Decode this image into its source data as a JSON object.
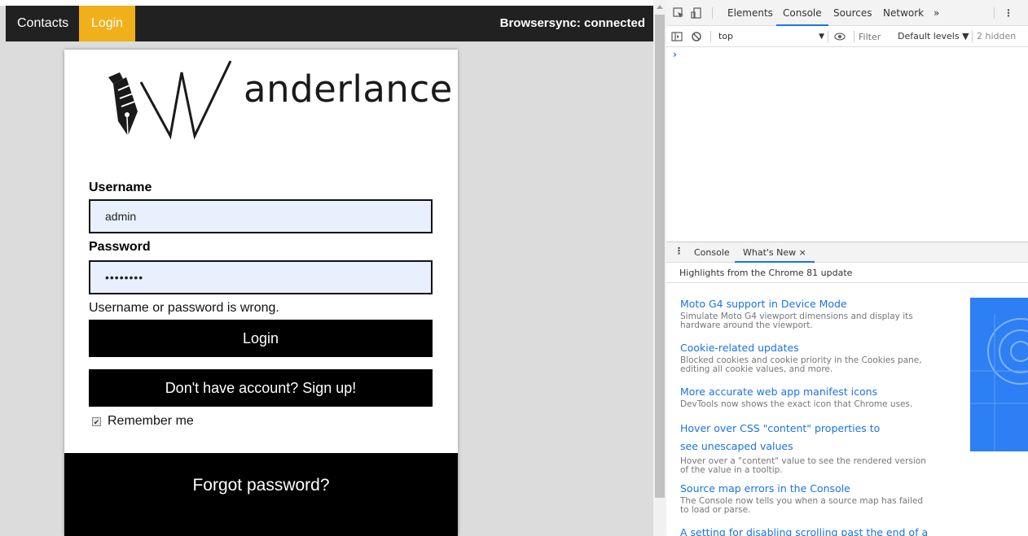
{
  "navbar": {
    "contacts_label": "Contacts",
    "login_label": "Login",
    "status_text": "Browsersync: connected"
  },
  "logo": {
    "text": "anderlance"
  },
  "form": {
    "username_label": "Username",
    "username_value": "admin",
    "password_label": "Password",
    "password_value": "••••••••",
    "error_message": "Username or password is wrong.",
    "login_button": "Login",
    "signup_button": "Don't have account? Sign up!",
    "remember_label": "Remember me",
    "remember_checked": true,
    "forgot_label": "Forgot password?"
  },
  "devtools": {
    "tabs": [
      "Elements",
      "Console",
      "Sources",
      "Network",
      "»"
    ],
    "active_tab": "Console",
    "context": "top",
    "filter_placeholder": "Filter",
    "levels_label": "Default levels ▼",
    "hidden_count": "2 hidden",
    "prompt": "›",
    "drawer_tabs": [
      "Console",
      "What's New"
    ],
    "drawer_active": "What's New",
    "close_glyph": "×",
    "highlights": "Highlights from the Chrome 81 update",
    "news": [
      {
        "title": "Moto G4 support in Device Mode",
        "desc": "Simulate Moto G4 viewport dimensions and display its hardware around the viewport."
      },
      {
        "title": "Cookie-related updates",
        "desc": "Blocked cookies and cookie priority in the Cookies pane, editing all cookie values, and more."
      },
      {
        "title": "More accurate web app manifest icons",
        "desc": "DevTools now shows the exact icon that Chrome uses."
      },
      {
        "title": "Hover over CSS \"content\" properties to see unescaped values",
        "desc": "Hover over a \"content\" value to see the rendered version of the value in a tooltip."
      },
      {
        "title": "Source map errors in the Console",
        "desc": "The Console now tells you when a source map has failed to load or parse."
      },
      {
        "title": "A setting for disabling scrolling past the end of a file",
        "desc": ""
      }
    ],
    "colors": {
      "accent": "#1a73e8"
    }
  },
  "colors": {
    "nav_bg": "#212121",
    "login_accent": "#f0b019",
    "page_bg": "#dcdcdc",
    "input_bg": "#e8f0fe"
  }
}
